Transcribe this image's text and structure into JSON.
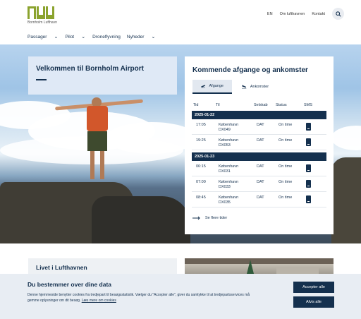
{
  "brand": {
    "logo_text": "RNN",
    "logo_subtitle": "Bornholm Lufthavn"
  },
  "utility": {
    "lang": "EN",
    "about": "Om lufthavnen",
    "contact": "Kontakt",
    "search_icon": "search-icon"
  },
  "nav": {
    "items": [
      {
        "label": "Passager",
        "has_dropdown": true
      },
      {
        "label": "Pilot",
        "has_dropdown": true
      },
      {
        "label": "Droneflyvning",
        "has_dropdown": false
      },
      {
        "label": "Nyheder",
        "has_dropdown": true
      }
    ]
  },
  "hero": {
    "welcome_title": "Velkommen til Bornholm Airport"
  },
  "flights": {
    "title": "Kommende afgange og ankomster",
    "tabs": {
      "departures": "Afgange",
      "arrivals": "Ankomster"
    },
    "columns": {
      "time": "Tid",
      "to": "Til",
      "company": "Selskab",
      "status": "Status",
      "sms": "SMS"
    },
    "days": [
      {
        "date": "2025-01-22",
        "rows": [
          {
            "time": "17:05",
            "dest": "København",
            "flight": "DX049",
            "carrier": "DAT",
            "status": "On time"
          },
          {
            "time": "19:25",
            "dest": "København",
            "flight": "DX053",
            "carrier": "DAT",
            "status": "On time"
          }
        ]
      },
      {
        "date": "2025-01-23",
        "rows": [
          {
            "time": "06:15",
            "dest": "København",
            "flight": "DX031",
            "carrier": "DAT",
            "status": "On time"
          },
          {
            "time": "07:00",
            "dest": "København",
            "flight": "DX033",
            "carrier": "DAT",
            "status": "On time"
          },
          {
            "time": "08:45",
            "dest": "København",
            "flight": "DX035",
            "carrier": "DAT",
            "status": "On time"
          }
        ]
      }
    ],
    "more_link": "Se flere tider"
  },
  "life": {
    "title": "Livet i Lufthavnen"
  },
  "cookie": {
    "title": "Du bestemmer over dine data",
    "text": "Denne hjemmeside benytter cookies fra tredjepart til besøgsstatistik. Vælger du \"Accepter alle\", giver du samtykke til at tredjepartsservices må gemme oplysninger om dit besøg.",
    "link": "Læs mere om cookies",
    "accept": "Accepter alle",
    "reject": "Afvis alle"
  },
  "colors": {
    "navy": "#14304e",
    "brand_green": "#8ba32e",
    "panel_blue": "#dfe9f6"
  }
}
